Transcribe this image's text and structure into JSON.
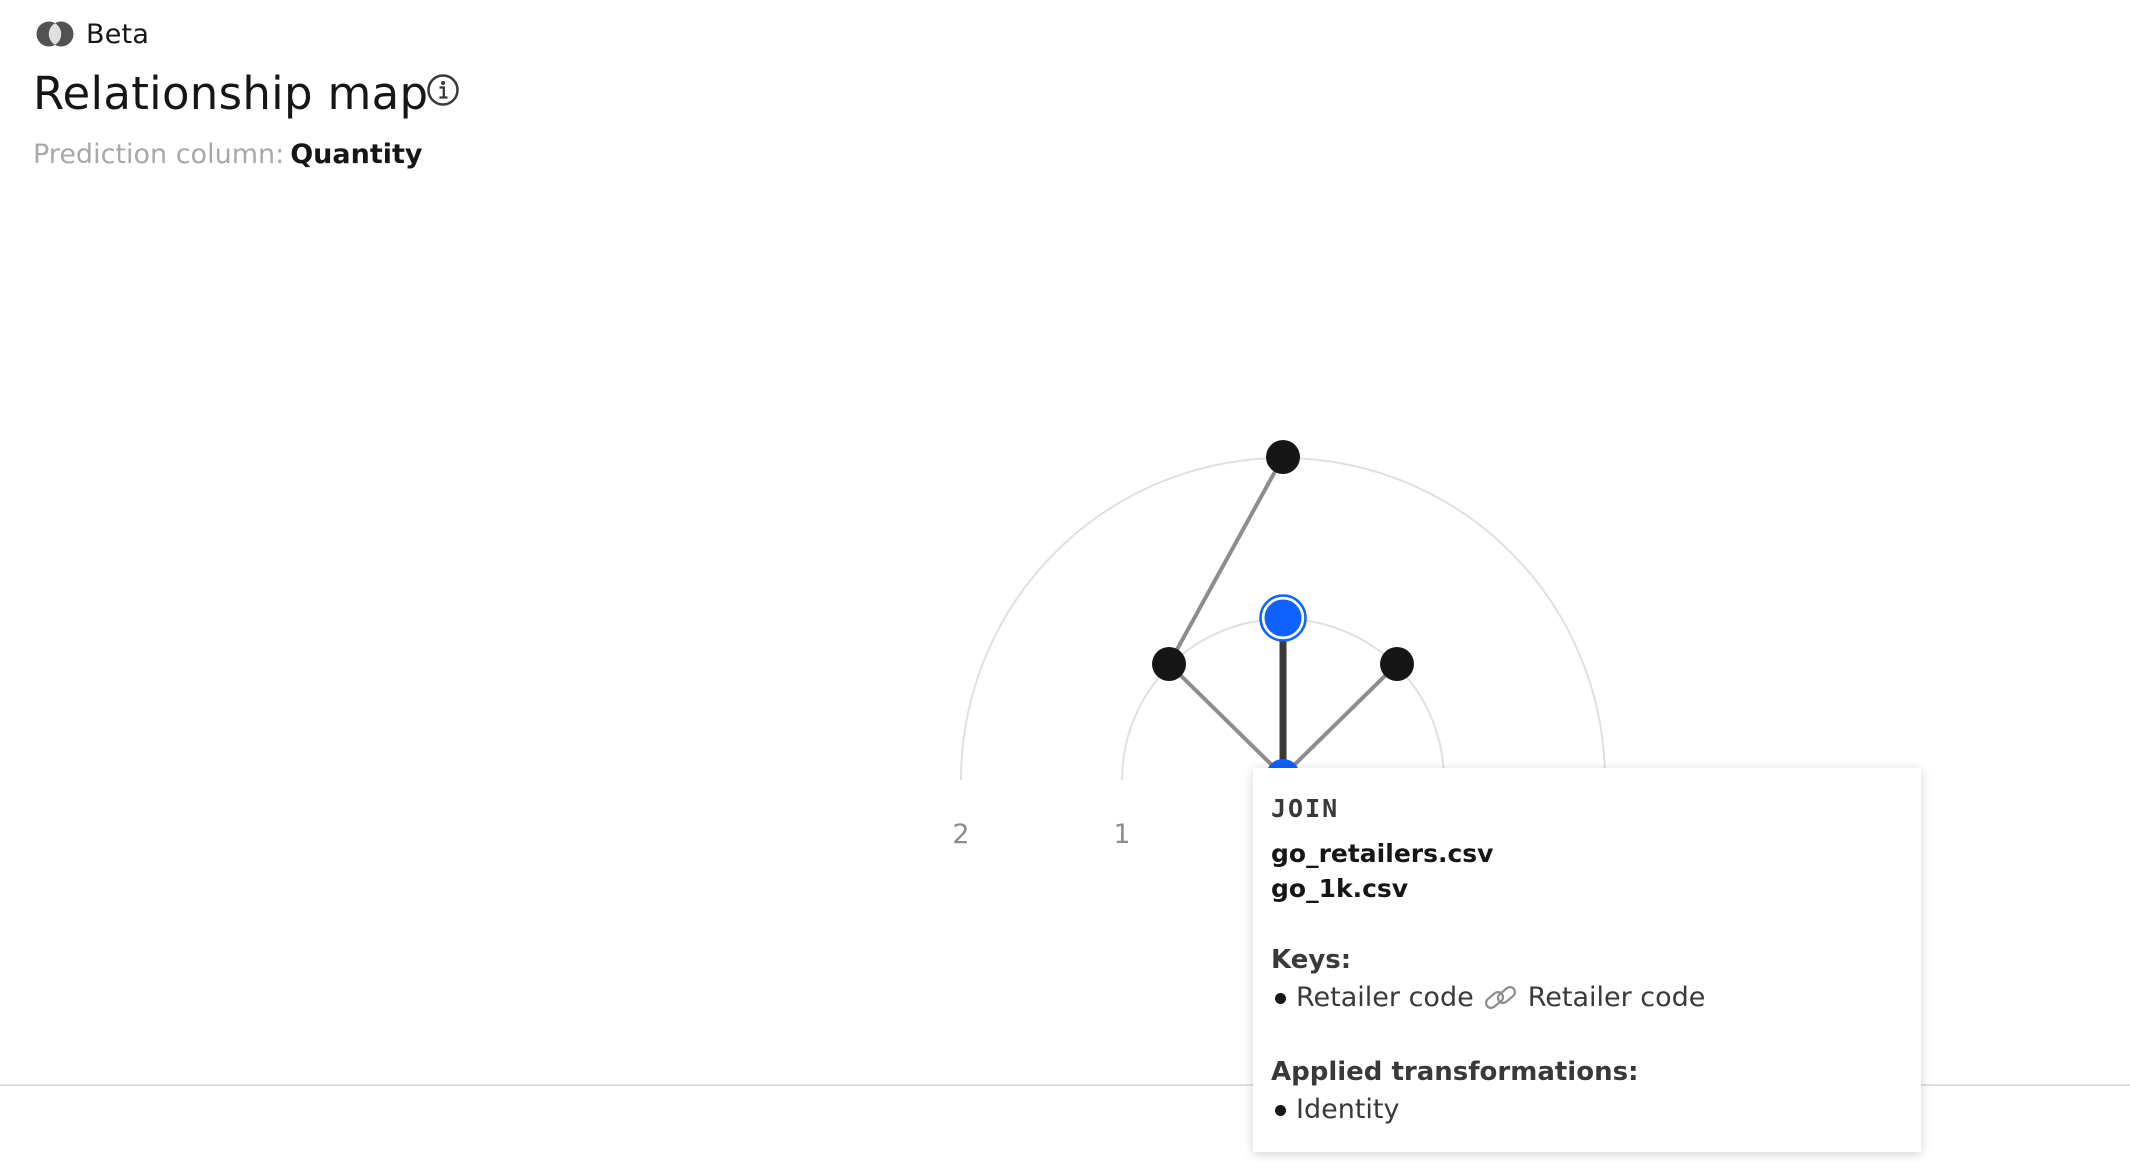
{
  "header": {
    "beta_label": "Beta",
    "beta_icon": "beta-icon",
    "title": "Relationship map",
    "info_icon": "info-icon",
    "prediction_label": "Prediction column:",
    "prediction_value": "Quantity"
  },
  "map": {
    "ring_labels": [
      "2",
      "1"
    ],
    "node_colors": {
      "selected": "#0f62fe",
      "default": "#161616"
    }
  },
  "tooltip": {
    "heading": "JOIN",
    "files": [
      "go_retailers.csv",
      "go_1k.csv"
    ],
    "keys_title": "Keys:",
    "key_left": "Retailer code",
    "key_icon": "link-icon",
    "key_right": "Retailer code",
    "transformations_title": "Applied transformations:",
    "transformations": [
      "Identity"
    ]
  }
}
